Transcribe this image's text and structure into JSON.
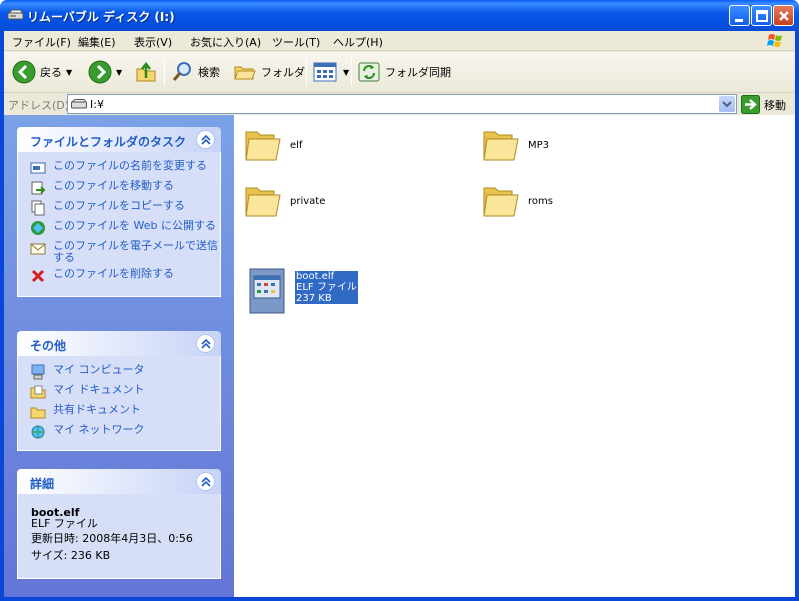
{
  "window": {
    "title": "リムーバブル ディスク (I:)"
  },
  "menu": {
    "items": [
      "ファイル(F)",
      "編集(E)",
      "表示(V)",
      "お気に入り(A)",
      "ツール(T)",
      "ヘルプ(H)"
    ]
  },
  "toolbar": {
    "back_label": "戻る",
    "search_label": "検索",
    "folders_label": "フォルダ",
    "sync_label": "フォルダ同期"
  },
  "address": {
    "label": "アドレス(D)",
    "path": "I:¥",
    "go_label": "移動"
  },
  "tasks_panel": {
    "title": "ファイルとフォルダのタスク",
    "links": [
      "このファイルの名前を変更する",
      "このファイルを移動する",
      "このファイルをコピーする",
      "このファイルを Web に公開する",
      "このファイルを電子メールで送信する",
      "このファイルを削除する"
    ]
  },
  "other_panel": {
    "title": "その他",
    "links": [
      "マイ コンピュータ",
      "マイ ドキュメント",
      "共有ドキュメント",
      "マイ ネットワーク"
    ]
  },
  "details_panel": {
    "title": "詳細",
    "name": "boot.elf",
    "type": "ELF ファイル",
    "modified": "更新日時: 2008年4月3日、0:56",
    "size": "サイズ: 236 KB"
  },
  "items": {
    "folders": [
      "elf",
      "MP3",
      "private",
      "roms"
    ],
    "file": {
      "name": "boot.elf",
      "type": "ELF ファイル",
      "size": "237 KB"
    }
  },
  "colors": {
    "titlebar": "#0a58e8",
    "panel_link": "#215dc6",
    "selection": "#316ac5"
  }
}
